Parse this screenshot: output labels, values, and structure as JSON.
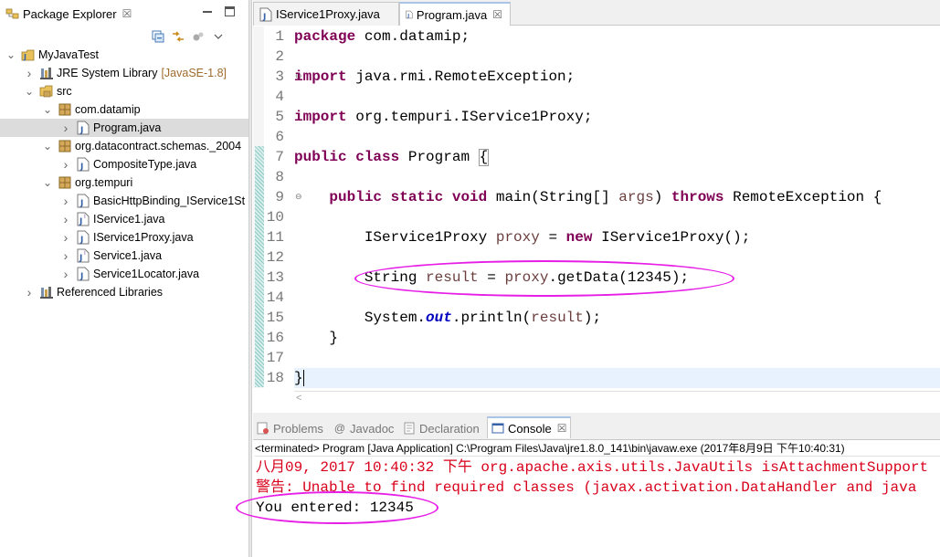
{
  "package_explorer": {
    "title": "Package Explorer",
    "close": "☒",
    "toolbar": [
      "collapse-all-icon",
      "link-with-editor-icon",
      "focus-icon",
      "view-menu-icon"
    ],
    "tree": [
      {
        "label": "MyJavaTest",
        "icon": "java-project-icon",
        "level": 0,
        "twisty": "open"
      },
      {
        "label": "JRE System Library",
        "decoration": "[JavaSE-1.8]",
        "icon": "library-icon",
        "level": 1,
        "twisty": "closed"
      },
      {
        "label": "src",
        "icon": "source-folder-icon",
        "level": 1,
        "twisty": "open"
      },
      {
        "label": "com.datamip",
        "icon": "package-icon",
        "level": 2,
        "twisty": "open"
      },
      {
        "label": "Program.java",
        "icon": "java-file-icon",
        "level": 3,
        "twisty": "closed",
        "selected": true
      },
      {
        "label": "org.datacontract.schemas._2004",
        "icon": "package-icon",
        "level": 2,
        "twisty": "open"
      },
      {
        "label": "CompositeType.java",
        "icon": "java-file-icon",
        "level": 3,
        "twisty": "closed"
      },
      {
        "label": "org.tempuri",
        "icon": "package-icon",
        "level": 2,
        "twisty": "open"
      },
      {
        "label": "BasicHttpBinding_IService1St",
        "icon": "java-file-icon",
        "level": 3,
        "twisty": "closed"
      },
      {
        "label": "IService1.java",
        "icon": "java-interface-icon",
        "level": 3,
        "twisty": "closed"
      },
      {
        "label": "IService1Proxy.java",
        "icon": "java-file-icon",
        "level": 3,
        "twisty": "closed"
      },
      {
        "label": "Service1.java",
        "icon": "java-interface-icon",
        "level": 3,
        "twisty": "closed"
      },
      {
        "label": "Service1Locator.java",
        "icon": "java-file-icon",
        "level": 3,
        "twisty": "closed"
      },
      {
        "label": "Referenced Libraries",
        "icon": "library-icon",
        "level": 1,
        "twisty": "closed"
      }
    ]
  },
  "editor": {
    "tabs": [
      {
        "label": "IService1Proxy.java",
        "active": false
      },
      {
        "label": "Program.java",
        "active": true,
        "close": "☒"
      }
    ],
    "line_numbers": [
      "1",
      "2",
      "3",
      "4",
      "5",
      "6",
      "7",
      "8",
      "9",
      "10",
      "11",
      "12",
      "13",
      "14",
      "15",
      "16",
      "17",
      "18"
    ],
    "fold_markers": {
      "3": "⊖",
      "9": "⊖"
    },
    "code": {
      "l1_kw": "package",
      "l1_rest": " com.datamip;",
      "l3_kw": "import",
      "l3_rest": " java.rmi.RemoteException;",
      "l5_kw": "import",
      "l5_rest": " org.tempuri.IService1Proxy;",
      "l7_kw1": "public",
      "l7_kw2": "class",
      "l7_name": " Program ",
      "l7_brace": "{",
      "l9_kw1": "public",
      "l9_kw2": "static",
      "l9_kw3": "void",
      "l9_a": " main(String[] ",
      "l9_var": "args",
      "l9_b": ") ",
      "l9_kw4": "throws",
      "l9_c": " RemoteException {",
      "l11_a": "IService1Proxy ",
      "l11_var": "proxy",
      "l11_b": " = ",
      "l11_kw": "new",
      "l11_c": " IService1Proxy();",
      "l13_a": "String ",
      "l13_var1": "result",
      "l13_b": " = ",
      "l13_var2": "proxy",
      "l13_c": ".getData(12345);",
      "l15_a": "System.",
      "l15_fld": "out",
      "l15_b": ".println(",
      "l15_var": "result",
      "l15_c": ");",
      "l16": "}",
      "l18": "}"
    },
    "scroll_left": "<"
  },
  "bottom_panel": {
    "tabs": [
      {
        "label": "Problems",
        "icon": "problems-icon",
        "active": false
      },
      {
        "label": "Javadoc",
        "icon": "javadoc-icon",
        "active": false
      },
      {
        "label": "Declaration",
        "icon": "declaration-icon",
        "active": false
      },
      {
        "label": "Console",
        "icon": "console-icon",
        "active": true,
        "close": "☒"
      }
    ],
    "terminated": "<terminated> Program [Java Application] C:\\Program Files\\Java\\jre1.8.0_141\\bin\\javaw.exe (2017年8月9日 下午10:40:31)",
    "console_lines": [
      {
        "text": "八月09, 2017 10:40:32 下午 org.apache.axis.utils.JavaUtils isAttachmentSupport",
        "kind": "error"
      },
      {
        "text": "警告: Unable to find required classes (javax.activation.DataHandler and java",
        "kind": "error"
      },
      {
        "text": "You entered: 12345",
        "kind": "output"
      }
    ]
  },
  "colors": {
    "keyword": "#7f0055",
    "local_var": "#6a3e3e",
    "static_field": "#0000c0",
    "stderr": "#d9001b",
    "highlight_ellipse": "#e61ee6",
    "current_line": "#e8f2fe",
    "selection": "#dcdcdc"
  }
}
